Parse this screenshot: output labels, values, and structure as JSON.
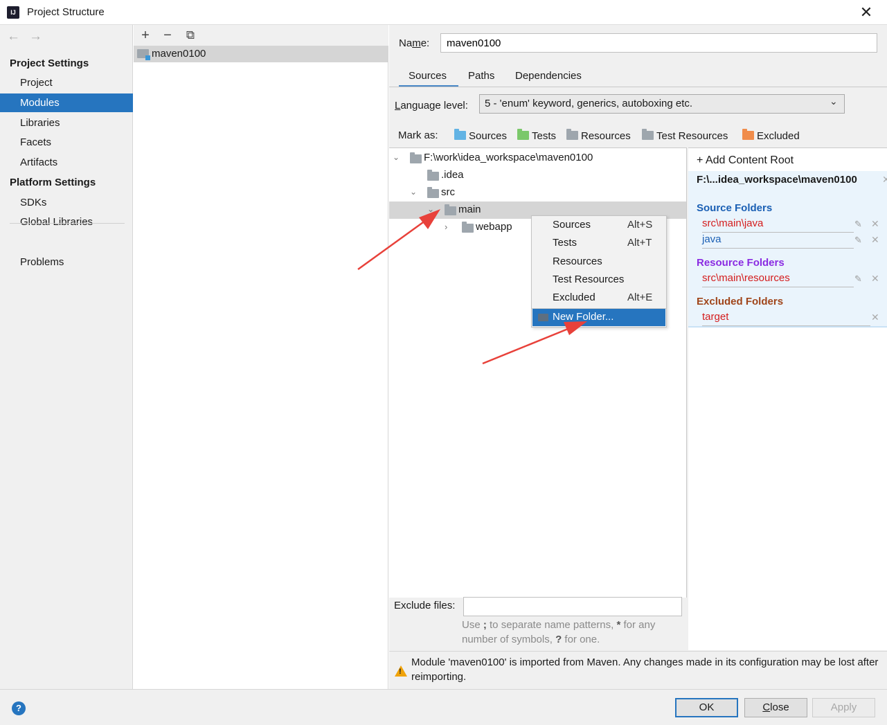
{
  "window": {
    "title": "Project Structure",
    "close_glyph": "✕",
    "icon_text": "IJ"
  },
  "nav": {
    "back": "←",
    "forward": "→",
    "project_settings": "Project Settings",
    "project_items": [
      "Project",
      "Modules",
      "Libraries",
      "Facets",
      "Artifacts"
    ],
    "platform_settings": "Platform Settings",
    "platform_items": [
      "SDKs",
      "Global Libraries"
    ],
    "problems": "Problems",
    "selected": "Modules"
  },
  "modules": {
    "toolbar": {
      "add": "+",
      "remove": "−",
      "copy": "⧉"
    },
    "items": [
      "maven0100"
    ]
  },
  "module": {
    "name_label": "Name:",
    "name_value": "maven0100",
    "tabs": [
      "Sources",
      "Paths",
      "Dependencies"
    ],
    "active_tab": "Sources",
    "language_level_label": "Language level:",
    "language_level_value": "5 - 'enum' keyword, generics, autoboxing etc.",
    "mark_as_label": "Mark as:",
    "mark_as": [
      {
        "label": "Sources",
        "color": "#62b3e4"
      },
      {
        "label": "Tests",
        "color": "#7bc86a"
      },
      {
        "label": "Resources",
        "color": "#9ea6ad"
      },
      {
        "label": "Test Resources",
        "color": "#9ea6ad"
      },
      {
        "label": "Excluded",
        "color": "#f08c4b"
      }
    ]
  },
  "tree": {
    "rows": [
      {
        "label": "F:\\work\\idea_workspace\\maven0100"
      },
      {
        "label": ".idea"
      },
      {
        "label": "src"
      },
      {
        "label": "main"
      },
      {
        "label": "webapp"
      }
    ]
  },
  "context_menu": {
    "items": [
      {
        "label": "Sources",
        "shortcut": "Alt+S"
      },
      {
        "label": "Tests",
        "shortcut": "Alt+T"
      },
      {
        "label": "Resources",
        "shortcut": ""
      },
      {
        "label": "Test Resources",
        "shortcut": ""
      },
      {
        "label": "Excluded",
        "shortcut": "Alt+E"
      }
    ],
    "new_folder": "New Folder..."
  },
  "content_root": {
    "add_label": "Add Content Root",
    "path": "F:\\...idea_workspace\\maven0100",
    "source_title": "Source Folders",
    "source_color": "#1a5fb4",
    "source_rows": [
      {
        "label": "src\\main\\java",
        "color": "#d41c1c"
      },
      {
        "label": "java",
        "color": "#1a5fb4"
      }
    ],
    "resource_title": "Resource Folders",
    "resource_color": "#8a2be2",
    "resource_rows": [
      {
        "label": "src\\main\\resources",
        "color": "#d41c1c"
      }
    ],
    "excluded_title": "Excluded Folders",
    "excluded_color": "#a0451a",
    "excluded_rows": [
      {
        "label": "target",
        "color": "#d41c1c"
      }
    ]
  },
  "exclude": {
    "label": "Exclude files:",
    "value": "",
    "hint_a": "Use ",
    "hint_b": ";",
    "hint_c": " to separate name patterns, ",
    "hint_d": "*",
    "hint_e": " for any number of symbols, ",
    "hint_f": "?",
    "hint_g": " for one."
  },
  "warning": {
    "text": "Module 'maven0100' is imported from Maven. Any changes made in its configuration may be lost after reimporting."
  },
  "footer": {
    "help": "?",
    "ok": "OK",
    "close": "Close",
    "apply": "Apply"
  }
}
